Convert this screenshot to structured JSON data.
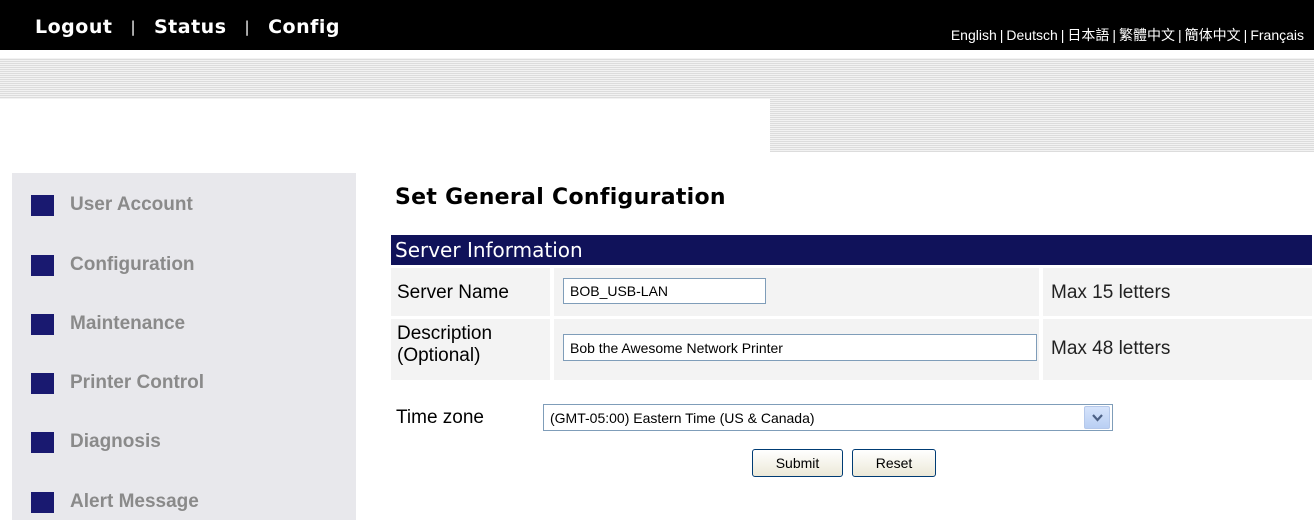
{
  "topnav": {
    "logout": "Logout",
    "status": "Status",
    "config": "Config",
    "separator": "|"
  },
  "languages": [
    "English",
    "Deutsch",
    "日本語",
    "繁體中文",
    "簡体中文",
    "Français"
  ],
  "sidebar": {
    "items": [
      {
        "label": "User Account",
        "icon": "square-bullet-icon"
      },
      {
        "label": "Configuration",
        "icon": "square-bullet-icon"
      },
      {
        "label": "Maintenance",
        "icon": "square-bullet-icon"
      },
      {
        "label": "Printer Control",
        "icon": "square-bullet-icon"
      },
      {
        "label": "Diagnosis",
        "icon": "square-bullet-icon"
      },
      {
        "label": "Alert Message",
        "icon": "square-bullet-icon"
      }
    ]
  },
  "main": {
    "title": "Set General Configuration",
    "section_header": "Server Information",
    "server_name": {
      "label": "Server Name",
      "value": "BOB_USB-LAN",
      "note": "Max 15 letters"
    },
    "description": {
      "label_line1": "Description",
      "label_line2": "(Optional)",
      "value": "Bob the Awesome Network Printer",
      "note": "Max 48 letters"
    },
    "time_zone": {
      "label": "Time zone",
      "selected": "(GMT-05:00) Eastern Time (US & Canada)"
    },
    "submit_label": "Submit",
    "reset_label": "Reset"
  },
  "colors": {
    "topbar": "#000000",
    "section_header": "#10125a",
    "sidebar_bg": "#e8e8ec",
    "sidebar_bullet": "#191970",
    "sidebar_text": "#8a8a8a"
  }
}
